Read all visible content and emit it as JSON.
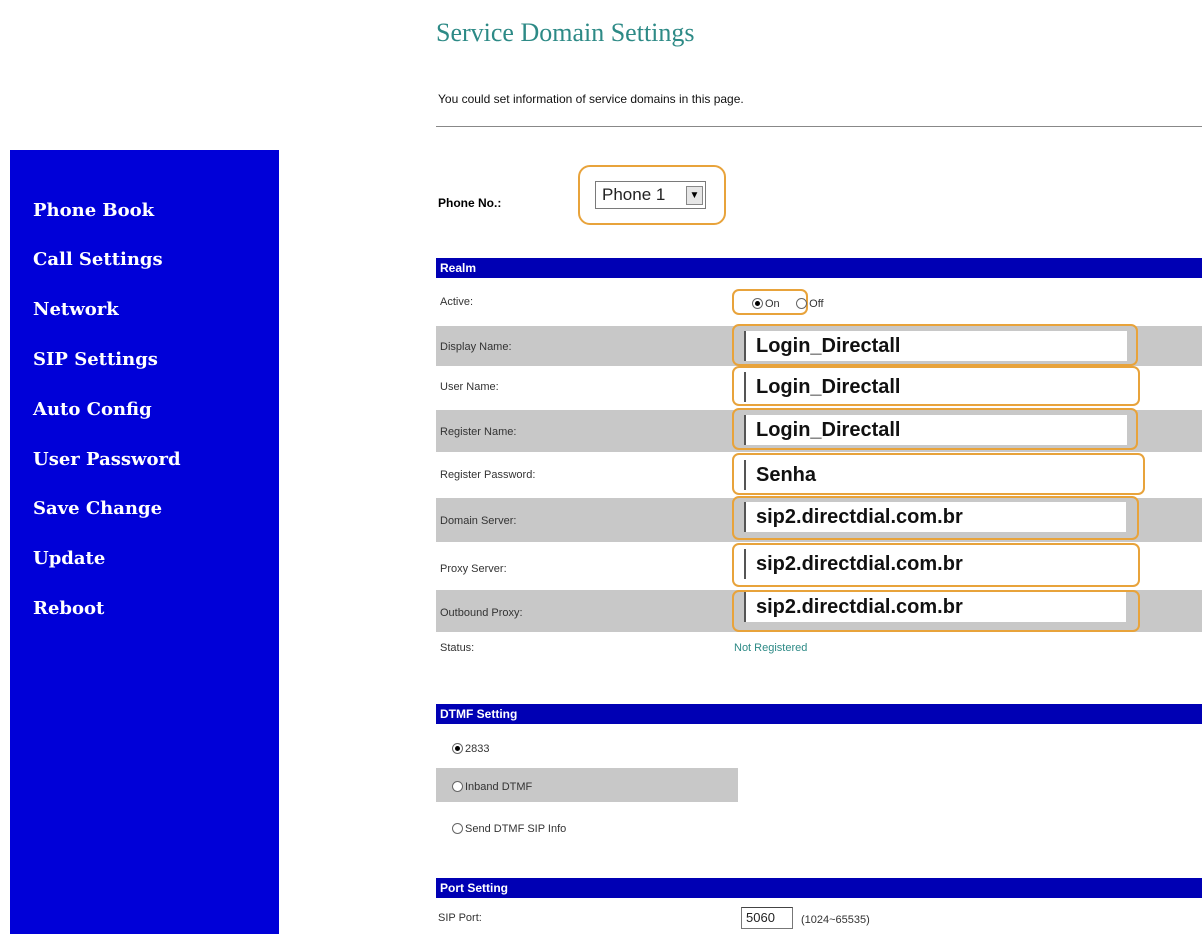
{
  "page": {
    "title": "Service Domain Settings",
    "intro": "You could set information of service domains in this page."
  },
  "sidebar": {
    "items": [
      {
        "label": "Phone Book"
      },
      {
        "label": "Call Settings"
      },
      {
        "label": "Network"
      },
      {
        "label": "SIP Settings"
      },
      {
        "label": "Auto Config"
      },
      {
        "label": "User Password"
      },
      {
        "label": "Save Change"
      },
      {
        "label": "Update"
      },
      {
        "label": "Reboot"
      }
    ]
  },
  "phone_select": {
    "label": "Phone No.:",
    "value": "Phone 1",
    "arrow": "▼"
  },
  "realm": {
    "header": "Realm",
    "active": {
      "label": "Active:",
      "on": "On",
      "off": "Off",
      "selected": "On"
    },
    "display_name": {
      "label": "Display Name:",
      "value": "Login_Directall"
    },
    "user_name": {
      "label": "User Name:",
      "value": "Login_Directall"
    },
    "register_name": {
      "label": "Register Name:",
      "value": "Login_Directall"
    },
    "register_password": {
      "label": "Register Password:",
      "value": "Senha"
    },
    "domain_server": {
      "label": "Domain Server:",
      "value": "sip2.directdial.com.br"
    },
    "proxy_server": {
      "label": "Proxy Server:",
      "value": "sip2.directdial.com.br"
    },
    "outbound_proxy": {
      "label": "Outbound Proxy:",
      "value": "sip2.directdial.com.br"
    },
    "status": {
      "label": "Status:",
      "value": "Not Registered"
    }
  },
  "dtmf": {
    "header": "DTMF Setting",
    "options": [
      {
        "label": "2833",
        "checked": true
      },
      {
        "label": "Inband DTMF",
        "checked": false
      },
      {
        "label": "Send DTMF SIP Info",
        "checked": false
      }
    ]
  },
  "port": {
    "header": "Port Setting",
    "sip_port": {
      "label": "SIP Port:",
      "value": "5060",
      "range": "(1024~65535)"
    }
  },
  "colors": {
    "sidebar_bg": "#0000d8",
    "section_header_bg": "#0000b4",
    "title_teal": "#2d8a86",
    "highlight_orange": "#e8a33b",
    "row_shade": "#c8c8c8"
  }
}
